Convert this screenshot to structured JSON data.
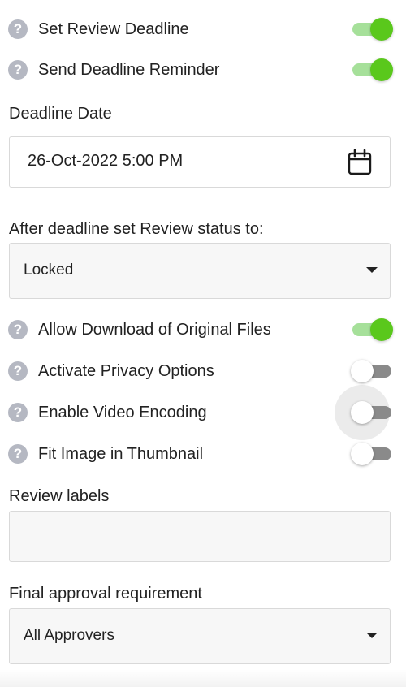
{
  "toggles_top": [
    {
      "label": "Set Review Deadline",
      "on": true
    },
    {
      "label": "Send Deadline Reminder",
      "on": true
    }
  ],
  "deadline": {
    "label": "Deadline Date",
    "value": "26-Oct-2022 5:00 PM",
    "icon": "calendar-icon"
  },
  "after_deadline": {
    "label": "After deadline set Review status to:",
    "selected": "Locked"
  },
  "toggles_middle": [
    {
      "label": "Allow Download of Original Files",
      "on": true
    },
    {
      "label": "Activate Privacy Options",
      "on": false
    },
    {
      "label": "Enable Video Encoding",
      "on": false,
      "focused": true
    },
    {
      "label": "Fit Image in Thumbnail",
      "on": false
    }
  ],
  "review_labels": {
    "label": "Review labels",
    "value": ""
  },
  "final_approval": {
    "label": "Final approval requirement",
    "selected": "All Approvers"
  },
  "help_icon_glyph": "?",
  "colors": {
    "toggle_on_thumb": "#5ac81c",
    "toggle_on_track": "#a6e09a",
    "toggle_off_track": "#8a8a8a",
    "help_icon": "#b5b8c2"
  }
}
